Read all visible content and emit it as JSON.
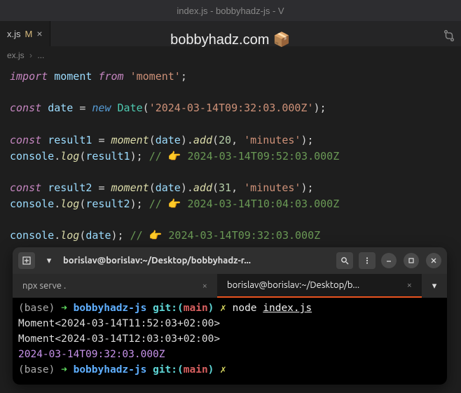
{
  "window": {
    "title": "index.js - bobbyhadz-js - V"
  },
  "tab": {
    "name": "x.js",
    "modified_marker": "M",
    "close": "×"
  },
  "watermark": "bobbyhadz.com 📦",
  "breadcrumb": {
    "file": "ex.js",
    "rest": "..."
  },
  "code": {
    "l1": {
      "kw1": "import",
      "v": "moment",
      "kw2": "from",
      "str": "'moment'",
      "end": ";"
    },
    "l3": {
      "kw": "const",
      "v": "date",
      "eq": "=",
      "new": "new",
      "cls": "Date",
      "op1": "(",
      "str": "'2024-03-14T09:32:03.000Z'",
      "op2": ");"
    },
    "l5": {
      "kw": "const",
      "v": "result1",
      "eq": "=",
      "fn": "moment",
      "op1": "(",
      "arg": "date",
      "op2": ").",
      "fn2": "add",
      "op3": "(",
      "num": "20",
      "c": ",",
      "str": "'minutes'",
      "op4": ");"
    },
    "l6": {
      "obj": "console",
      "dot": ".",
      "fn": "log",
      "op1": "(",
      "arg": "result1",
      "op2": ");",
      "cm": "// 👉️ 2024-03-14T09:52:03.000Z"
    },
    "l8": {
      "kw": "const",
      "v": "result2",
      "eq": "=",
      "fn": "moment",
      "op1": "(",
      "arg": "date",
      "op2": ").",
      "fn2": "add",
      "op3": "(",
      "num": "31",
      "c": ",",
      "str": "'minutes'",
      "op4": ");"
    },
    "l9": {
      "obj": "console",
      "dot": ".",
      "fn": "log",
      "op1": "(",
      "arg": "result2",
      "op2": ");",
      "cm": "// 👉️ 2024-03-14T10:04:03.000Z"
    },
    "l11": {
      "obj": "console",
      "dot": ".",
      "fn": "log",
      "op1": "(",
      "arg": "date",
      "op2": ");",
      "cm": "// 👉️ 2024-03-14T09:32:03.000Z"
    }
  },
  "terminal": {
    "header": {
      "title": "borislav@borislav:~/Desktop/bobbyhadz-r..."
    },
    "tabs": {
      "t1": "npx serve .",
      "t2": "borislav@borislav:~/Desktop/b..."
    },
    "lines": {
      "p_base": "(base)",
      "p_arrow": "➜",
      "p_dir": "bobbyhadz-js",
      "p_git": "git:(",
      "p_branch": "main",
      "p_gitend": ")",
      "p_x": "✗",
      "cmd_node": "node",
      "cmd_file": "index.js",
      "out1": "Moment<2024-03-14T11:52:03+02:00>",
      "out2": "Moment<2024-03-14T12:03:03+02:00>",
      "out3": "2024-03-14T09:32:03.000Z"
    }
  }
}
